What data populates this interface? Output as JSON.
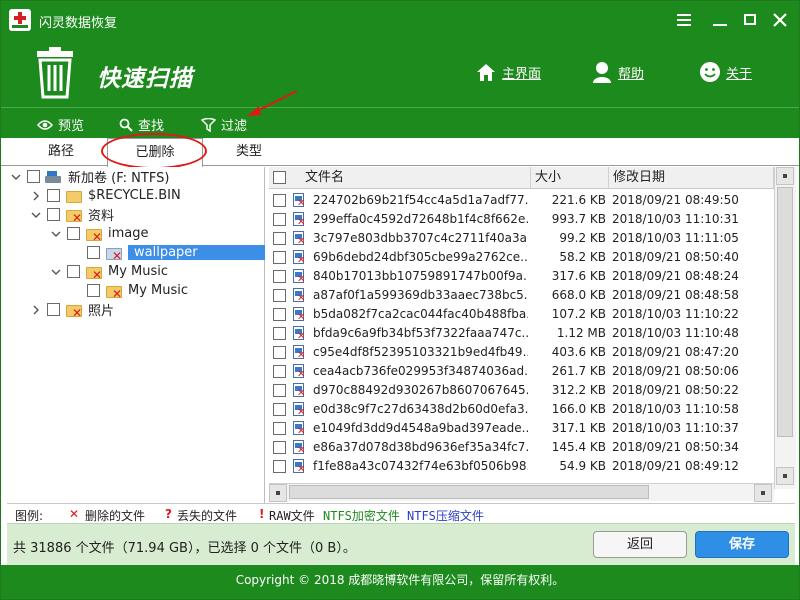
{
  "titlebar": {
    "title": "闪灵数据恢复"
  },
  "header": {
    "heading": "快速扫描",
    "links": [
      {
        "label": "主界面",
        "icon": "home-icon"
      },
      {
        "label": "帮助",
        "icon": "user-help-icon"
      },
      {
        "label": "关于",
        "icon": "smiley-icon"
      }
    ]
  },
  "toolbar": {
    "preview": "预览",
    "search": "查找",
    "filter": "过滤"
  },
  "tabs": [
    "路径",
    "已删除",
    "类型"
  ],
  "tree": {
    "items": [
      {
        "label": "新加卷 (F: NTFS)",
        "icon": "drive-icon"
      },
      {
        "label": "$RECYCLE.BIN",
        "icon": "folder-icon"
      },
      {
        "label": "资料",
        "icon": "deleted-folder-icon"
      },
      {
        "label": "image",
        "icon": "deleted-folder-icon"
      },
      {
        "label": "wallpaper",
        "icon": "deleted-folder-icon"
      },
      {
        "label": "My Music",
        "icon": "deleted-folder-icon"
      },
      {
        "label": "My Music",
        "icon": "deleted-folder-icon"
      },
      {
        "label": "照片",
        "icon": "deleted-folder-icon"
      }
    ]
  },
  "filelist": {
    "columns": {
      "name": "文件名",
      "size": "大小",
      "date": "修改日期"
    },
    "rows": [
      {
        "name": "224702b69b21f54cc4a5d1a7adf77...",
        "size": "221.6 KB",
        "date": "2018/09/21 08:49:50"
      },
      {
        "name": "299effa0c4592d72648b1f4c8f662e...",
        "size": "993.7 KB",
        "date": "2018/10/03 11:10:31"
      },
      {
        "name": "3c797e803dbb3707c4c2711f40a3a...",
        "size": "99.2 KB",
        "date": "2018/10/03 11:11:05"
      },
      {
        "name": "69b6debd24dbf305cbe99a2762ce...",
        "size": "58.2 KB",
        "date": "2018/09/21 08:50:40"
      },
      {
        "name": "840b17013bb10759891747b00f9a...",
        "size": "317.6 KB",
        "date": "2018/09/21 08:48:24"
      },
      {
        "name": "a87af0f1a599369db33aaec738bc5...",
        "size": "668.0 KB",
        "date": "2018/09/21 08:48:58"
      },
      {
        "name": "b5da082f7ca2cac044fac40b488fba...",
        "size": "107.2 KB",
        "date": "2018/10/03 11:10:22"
      },
      {
        "name": "bfda9c6a9fb34bf53f7322faaa747c...",
        "size": "1.12 MB",
        "date": "2018/10/03 11:10:48"
      },
      {
        "name": "c95e4df8f52395103321b9ed4fb49...",
        "size": "403.6 KB",
        "date": "2018/09/21 08:47:20"
      },
      {
        "name": "cea4acb736fe029953f34874036ad...",
        "size": "261.7 KB",
        "date": "2018/09/21 08:50:06"
      },
      {
        "name": "d970c88492d930267b8607067645...",
        "size": "312.2 KB",
        "date": "2018/09/21 08:50:22"
      },
      {
        "name": "e0d38c9f7c27d63438d2b60d0efa3...",
        "size": "166.0 KB",
        "date": "2018/10/03 11:10:58"
      },
      {
        "name": "e1049fd3dd9d4548a9bad397eade...",
        "size": "317.1 KB",
        "date": "2018/10/03 11:10:37"
      },
      {
        "name": "e86a37d078d38bd9636ef35a34fc7...",
        "size": "145.4 KB",
        "date": "2018/09/21 08:50:34"
      },
      {
        "name": "f1fe88a43c07432f74e63bf0506b98...",
        "size": "54.9 KB",
        "date": "2018/09/21 08:49:12"
      }
    ]
  },
  "legend": {
    "title": "图例:",
    "deleted": "删除的文件",
    "lost": "丢失的文件",
    "raw": "RAW文件",
    "ntfs_encrypted": "NTFS加密文件",
    "ntfs_compressed": "NTFS压缩文件"
  },
  "status": {
    "summary": "共 31886 个文件（71.94 GB），已选择 0 个文件（0 B）。",
    "back_label": "返回",
    "save_label": "保存"
  },
  "footer": {
    "copyright": "Copyright © 2018 成都晓博软件有限公司，保留所有权利。"
  },
  "colors": {
    "brand_green": "#1d8a1d",
    "accent_blue": "#2f8fe6",
    "deleted_red": "#e01818",
    "selection_blue": "#3d8ee6"
  }
}
